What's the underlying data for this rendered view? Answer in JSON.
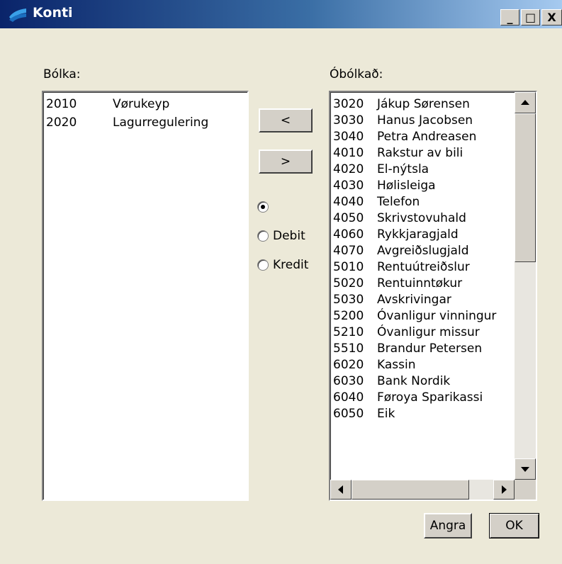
{
  "window": {
    "title": "Konti",
    "controls": {
      "minimize": "_",
      "maximize": "□",
      "close": "X"
    }
  },
  "left_list": {
    "label": "Bólka:",
    "items": [
      {
        "code": "2010",
        "name": "Vørukeyp"
      },
      {
        "code": "2020",
        "name": "Lagurregulering"
      }
    ]
  },
  "right_list": {
    "label": "Óbólkað:",
    "items": [
      {
        "code": "3020",
        "name": "Jákup Sørensen"
      },
      {
        "code": "3030",
        "name": "Hanus Jacobsen"
      },
      {
        "code": "3040",
        "name": "Petra Andreasen"
      },
      {
        "code": "4010",
        "name": "Rakstur av bili"
      },
      {
        "code": "4020",
        "name": "El-nýtsla"
      },
      {
        "code": "4030",
        "name": "Hølisleiga"
      },
      {
        "code": "4040",
        "name": "Telefon"
      },
      {
        "code": "4050",
        "name": "Skrivstovuhald"
      },
      {
        "code": "4060",
        "name": "Rykkjaragjald"
      },
      {
        "code": "4070",
        "name": "Avgreiðslugjald"
      },
      {
        "code": "5010",
        "name": "Rentuútreiðslur"
      },
      {
        "code": "5020",
        "name": "Rentuinntøkur"
      },
      {
        "code": "5030",
        "name": "Avskrivingar"
      },
      {
        "code": "5200",
        "name": "Óvanligur vinningur"
      },
      {
        "code": "5210",
        "name": "Óvanligur missur"
      },
      {
        "code": "5510",
        "name": "Brandur Petersen"
      },
      {
        "code": "6020",
        "name": "Kassin"
      },
      {
        "code": "6030",
        "name": "Bank Nordik"
      },
      {
        "code": "6040",
        "name": "Føroya Sparikassi"
      },
      {
        "code": "6050",
        "name": "Eik"
      }
    ]
  },
  "move_buttons": {
    "left": "<",
    "right": ">"
  },
  "radios": [
    {
      "label": "",
      "checked": true
    },
    {
      "label": "Debit",
      "checked": false
    },
    {
      "label": "Kredit",
      "checked": false
    }
  ],
  "buttons": {
    "cancel": "Angra",
    "ok": "OK"
  }
}
